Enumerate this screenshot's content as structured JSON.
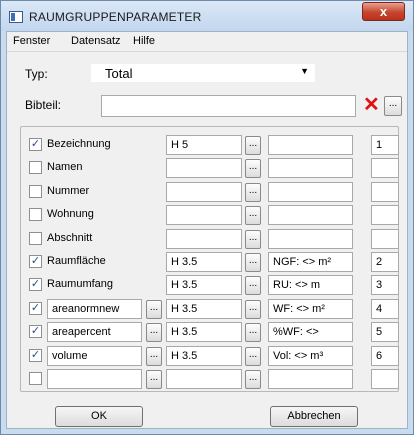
{
  "window": {
    "title": "RAUMGRUPPENPARAMETER",
    "close_glyph": "x"
  },
  "menu": {
    "items": [
      "Fenster",
      "Datensatz",
      "Hilfe"
    ]
  },
  "typ": {
    "label": "Typ:",
    "value": "Total"
  },
  "bibteil": {
    "label": "Bibteil:",
    "value": ""
  },
  "rows": [
    {
      "checked": true,
      "label": "Bezeichnung",
      "editable_label": false,
      "format": "H 5",
      "unit": "",
      "num": "1"
    },
    {
      "checked": false,
      "label": "Namen",
      "editable_label": false,
      "format": "",
      "unit": "",
      "num": ""
    },
    {
      "checked": false,
      "label": "Nummer",
      "editable_label": false,
      "format": "",
      "unit": "",
      "num": ""
    },
    {
      "checked": false,
      "label": "Wohnung",
      "editable_label": false,
      "format": "",
      "unit": "",
      "num": ""
    },
    {
      "checked": false,
      "label": "Abschnitt",
      "editable_label": false,
      "format": "",
      "unit": "",
      "num": ""
    },
    {
      "checked": true,
      "label": "Raumfläche",
      "editable_label": false,
      "format": "H 3.5",
      "unit": "NGF: <> m²",
      "num": "2"
    },
    {
      "checked": true,
      "label": "Raumumfang",
      "editable_label": false,
      "format": "H 3.5",
      "unit": "RU: <> m",
      "num": "3"
    },
    {
      "checked": true,
      "label": "areanormnew",
      "editable_label": true,
      "format": "H 3.5",
      "unit": "WF: <> m²",
      "num": "4"
    },
    {
      "checked": true,
      "label": "areapercent",
      "editable_label": true,
      "format": "H 3.5",
      "unit": "%WF: <>",
      "num": "5"
    },
    {
      "checked": true,
      "label": "volume",
      "editable_label": true,
      "format": "H 3.5",
      "unit": "Vol: <> m³",
      "num": "6"
    },
    {
      "checked": false,
      "label": "",
      "editable_label": true,
      "format": "",
      "unit": "",
      "num": ""
    }
  ],
  "buttons": {
    "ok": "OK",
    "cancel": "Abbrechen",
    "browse": "..."
  },
  "icons": {
    "delete": "red-x-icon",
    "dropdown": "dropdown-arrow-icon",
    "check": "checkmark-icon"
  }
}
